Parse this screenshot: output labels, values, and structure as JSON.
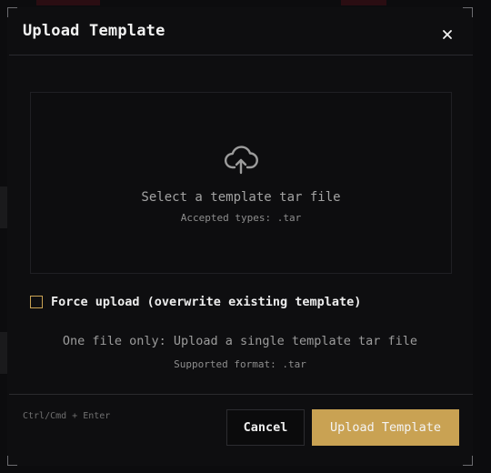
{
  "dialog": {
    "title": "Upload Template",
    "close_icon": "close-icon"
  },
  "dropzone": {
    "icon": "cloud-upload-icon",
    "primary_text": "Select a template tar file",
    "secondary_text": "Accepted types: .tar"
  },
  "force_upload": {
    "label": "Force upload (overwrite existing template)",
    "checked": false
  },
  "info": {
    "line": "One file only: Upload a single template tar file",
    "format": "Supported format: .tar"
  },
  "footer": {
    "shortcut": "Ctrl/Cmd + Enter",
    "cancel_label": "Cancel",
    "upload_label": "Upload Template"
  },
  "colors": {
    "accent": "#c9a253",
    "background": "#0e0e10",
    "border": "#2a2a2e"
  }
}
